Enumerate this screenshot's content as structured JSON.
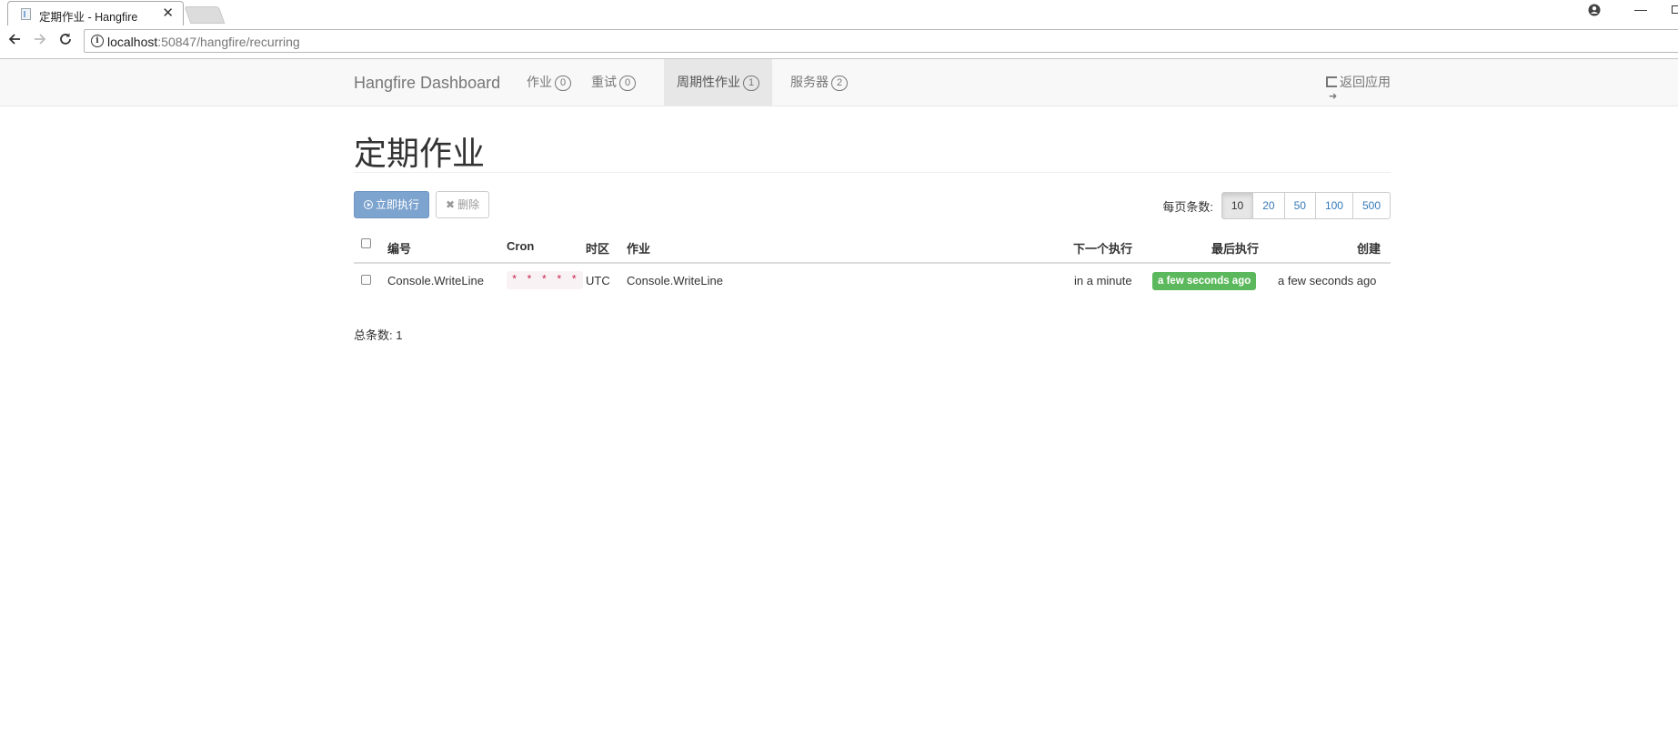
{
  "browser": {
    "tab_title": "定期作业 - Hangfire",
    "tab_close": "✕",
    "url_host": "localhost",
    "url_rest": ":50847/hangfire/recurring"
  },
  "navbar": {
    "brand": "Hangfire Dashboard",
    "items": [
      {
        "label": "作业",
        "badge": "0"
      },
      {
        "label": "重试",
        "badge": "0"
      },
      {
        "label": "周期性作业",
        "badge": "1"
      },
      {
        "label": "服务器",
        "badge": "2"
      }
    ],
    "back_to_app": "返回应用"
  },
  "page": {
    "title": "定期作业",
    "trigger_button": "立即执行",
    "delete_button": "删除",
    "per_page_label": "每页条数:",
    "per_page_options": [
      "10",
      "20",
      "50",
      "100",
      "500"
    ],
    "per_page_selected": "10",
    "total": "总条数: 1"
  },
  "table": {
    "headers": {
      "id": "编号",
      "cron": "Cron",
      "timezone": "时区",
      "job": "作业",
      "next": "下一个执行",
      "last": "最后执行",
      "created": "创建"
    },
    "rows": [
      {
        "id": "Console.WriteLine",
        "cron": "* * * * *",
        "timezone": "UTC",
        "job": "Console.WriteLine",
        "next": "in a minute",
        "last": "a few seconds ago",
        "created": "a few seconds ago"
      }
    ]
  },
  "colors": {
    "primary_button": "#7da3cf",
    "success_label": "#5cb85c",
    "cron_code": "#c7254e",
    "link": "#337ab7"
  }
}
